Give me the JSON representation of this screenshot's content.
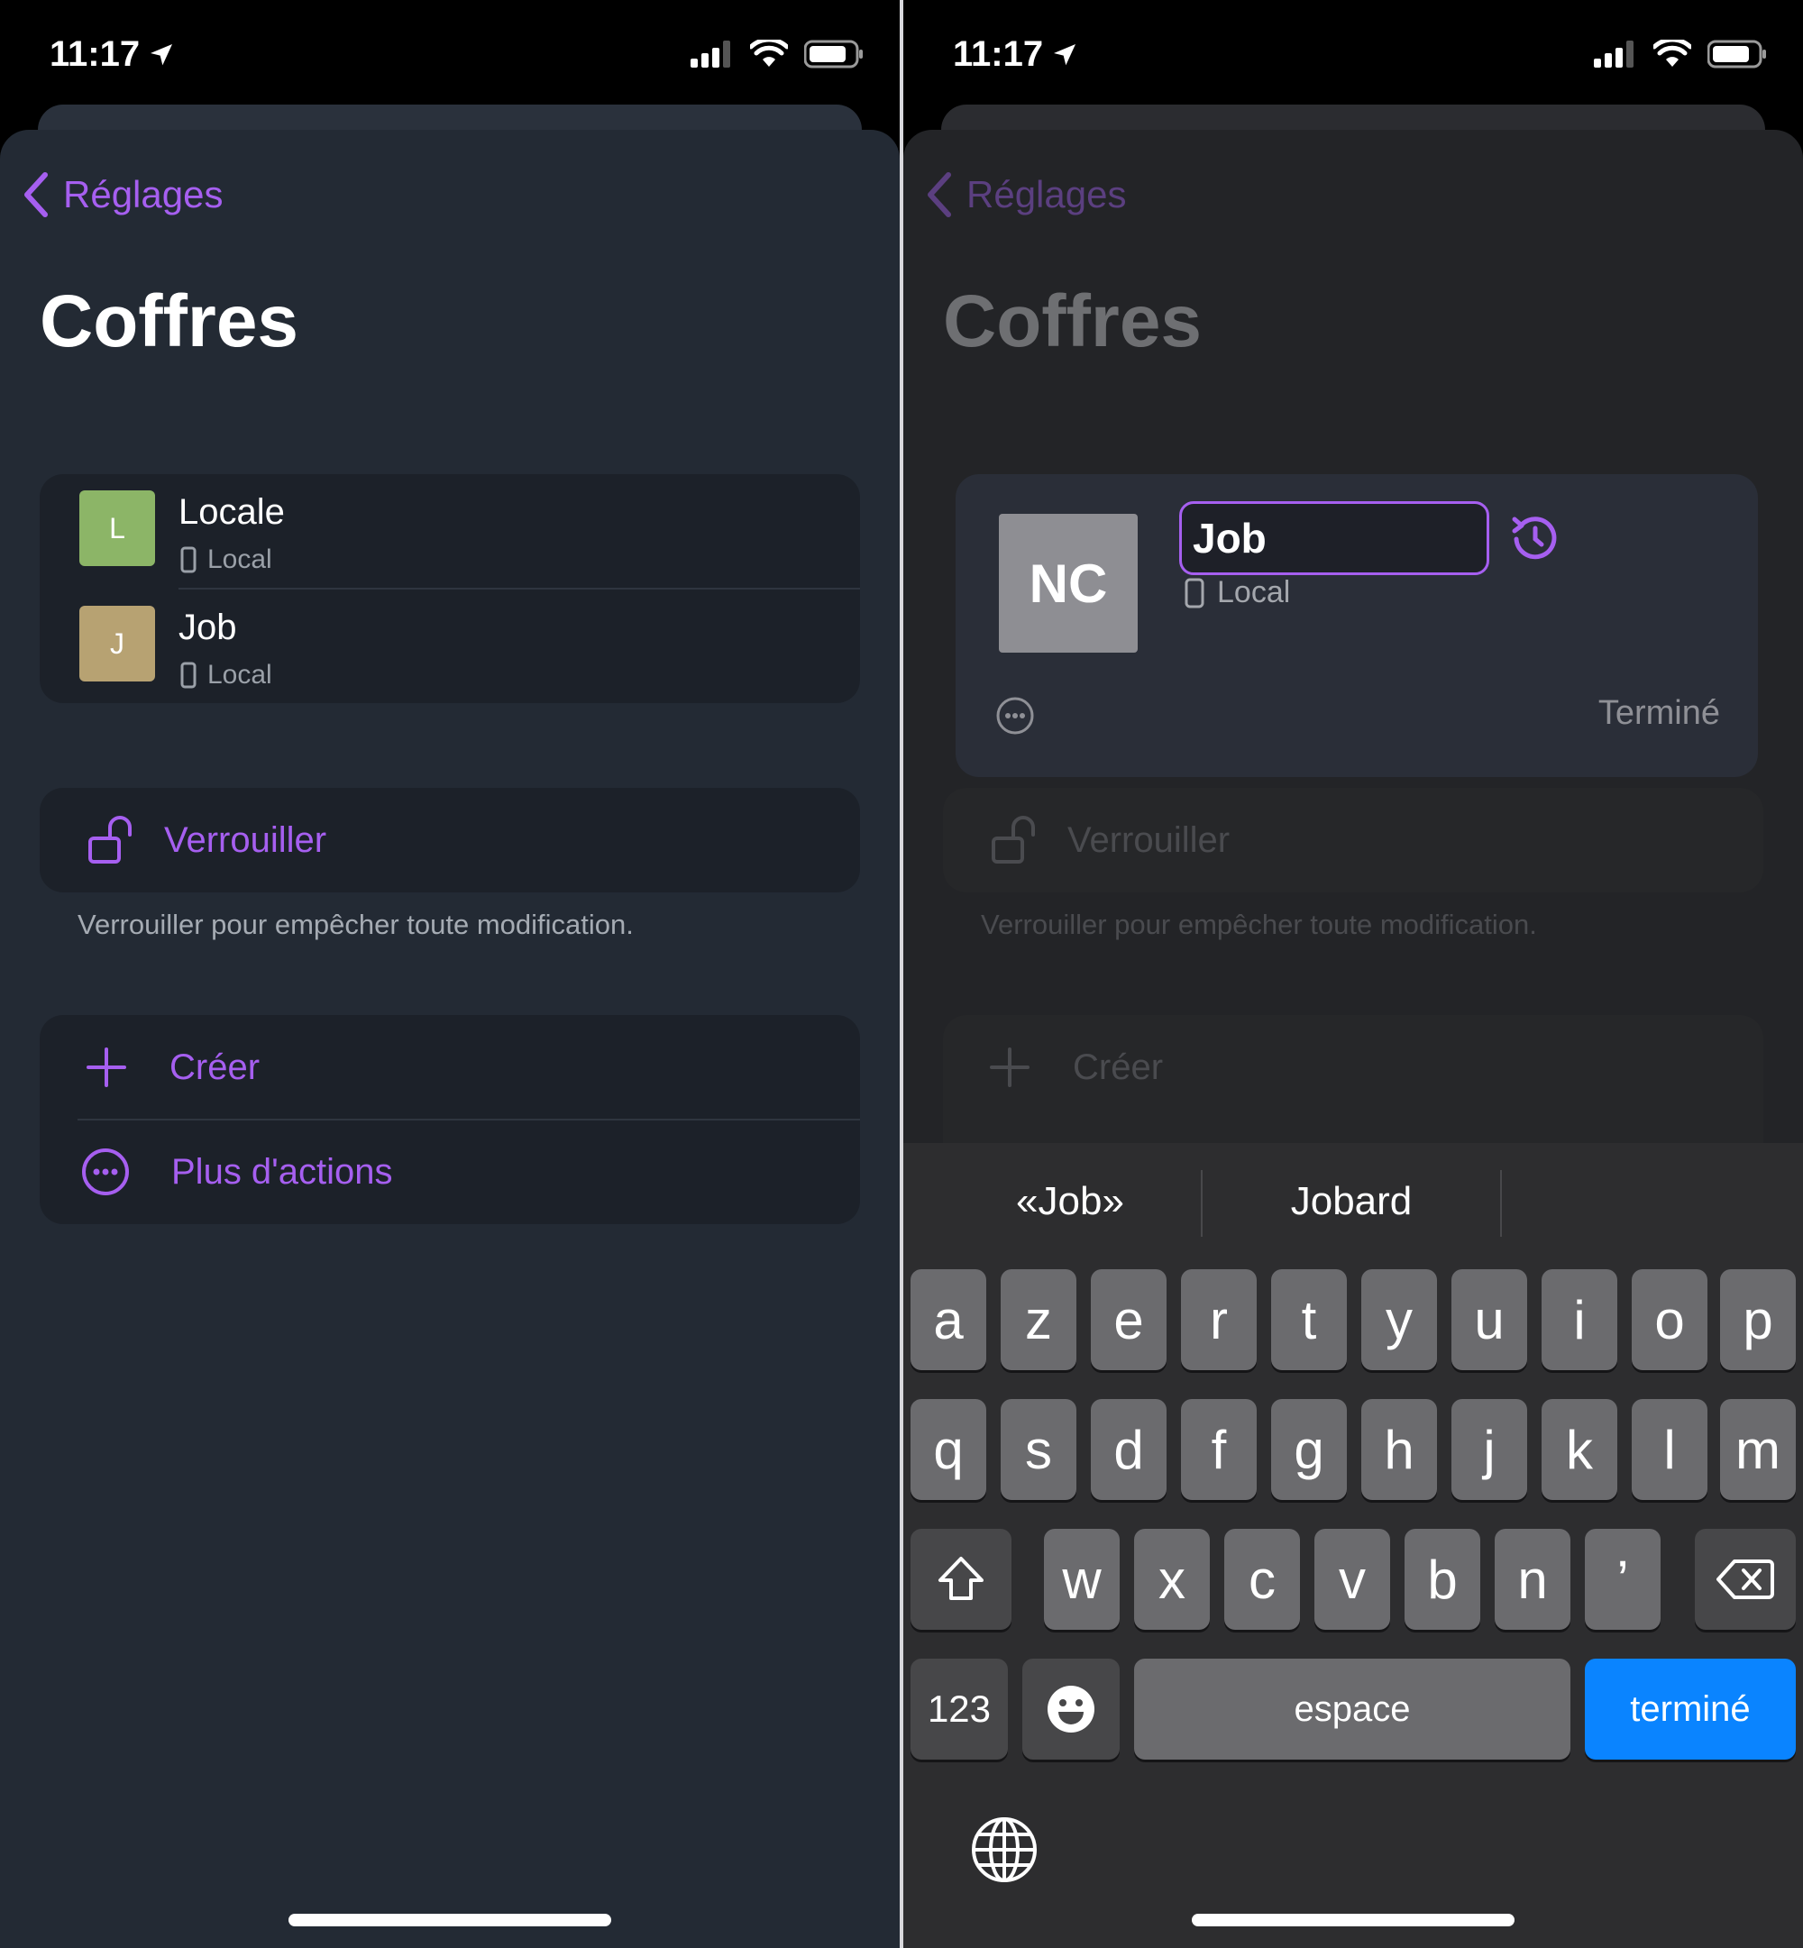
{
  "status": {
    "time": "11:17"
  },
  "nav": {
    "back_label": "Réglages"
  },
  "page": {
    "title": "Coffres"
  },
  "vaults": [
    {
      "initial": "L",
      "name": "Locale",
      "storage": "Local",
      "color": "#8cb567"
    },
    {
      "initial": "J",
      "name": "Job",
      "storage": "Local",
      "color": "#b7a272"
    }
  ],
  "lock": {
    "label": "Verrouiller",
    "footnote": "Verrouiller pour empêcher toute modification."
  },
  "actions": {
    "create_label": "Créer",
    "more_label": "Plus d'actions"
  },
  "edit": {
    "avatar_initials": "NC",
    "name_value": "Job",
    "storage": "Local",
    "done_label": "Terminé"
  },
  "keyboard": {
    "suggestions": [
      "«Job»",
      "Jobard"
    ],
    "row1": [
      "a",
      "z",
      "e",
      "r",
      "t",
      "y",
      "u",
      "i",
      "o",
      "p"
    ],
    "row2": [
      "q",
      "s",
      "d",
      "f",
      "g",
      "h",
      "j",
      "k",
      "l",
      "m"
    ],
    "row3": [
      "w",
      "x",
      "c",
      "v",
      "b",
      "n",
      "’"
    ],
    "numbers_label": "123",
    "space_label": "espace",
    "done_label": "terminé"
  },
  "colors": {
    "accent": "#a65ff0",
    "keyboard_done": "#0a84ff"
  }
}
